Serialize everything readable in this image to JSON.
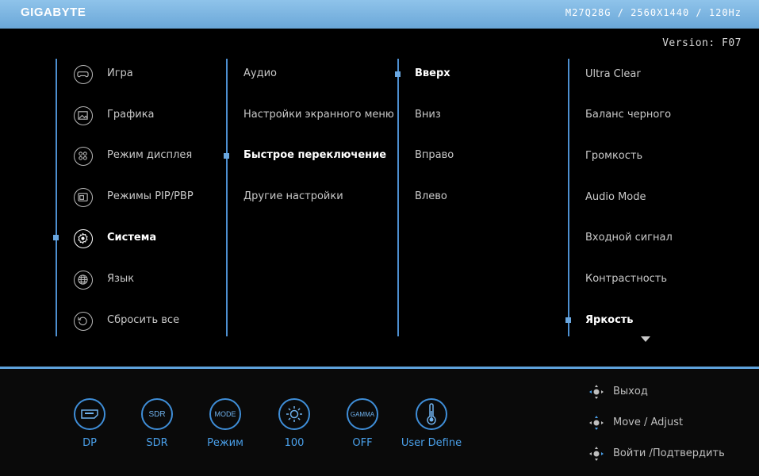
{
  "header": {
    "brand": "GIGABYTE",
    "model_info": "M27Q28G / 2560X1440 / 120Hz",
    "version": "Version: F07"
  },
  "main_menu": {
    "items": [
      {
        "label": "Игра",
        "icon": "gamepad-icon"
      },
      {
        "label": "Графика",
        "icon": "picture-icon"
      },
      {
        "label": "Режим дисплея",
        "icon": "display-mode-icon"
      },
      {
        "label": "Режимы PIP/PBP",
        "icon": "pip-icon"
      },
      {
        "label": "Система",
        "icon": "gear-icon"
      },
      {
        "label": "Язык",
        "icon": "globe-icon"
      },
      {
        "label": "Сбросить все",
        "icon": "reset-icon"
      }
    ],
    "selected_index": 4
  },
  "submenu": {
    "items": [
      "Аудио",
      "Настройки экранного меню",
      "Быстрое переключение",
      "Другие настройки"
    ],
    "selected_index": 2
  },
  "directions": {
    "items": [
      "Вверх",
      "Вниз",
      "Вправо",
      "Влево"
    ],
    "selected_index": 0
  },
  "options": {
    "items": [
      "Ultra Clear",
      "Баланс черного",
      "Громкость",
      "Audio Mode",
      "Входной сигнал",
      "Контрастность",
      "Яркость"
    ],
    "selected_index": 6
  },
  "status_bar": [
    {
      "icon": "input-port-icon",
      "icon_text": "",
      "label": "DP"
    },
    {
      "icon": "sdr-icon",
      "icon_text": "SDR",
      "label": "SDR"
    },
    {
      "icon": "mode-icon",
      "icon_text": "MODE",
      "label": "Режим"
    },
    {
      "icon": "brightness-icon",
      "icon_text": "",
      "label": "100"
    },
    {
      "icon": "gamma-icon",
      "icon_text": "GAMMA",
      "label": "OFF"
    },
    {
      "icon": "thermometer-icon",
      "icon_text": "",
      "label": "User Define"
    }
  ],
  "navigation_hints": [
    {
      "icon": "joystick-left-icon",
      "label": "Выход"
    },
    {
      "icon": "joystick-move-icon",
      "label": "Move / Adjust"
    },
    {
      "icon": "joystick-press-icon",
      "label": "Войти /Подтвердить"
    }
  ],
  "colors": {
    "header": "#6aa7d8",
    "accent": "#4d8fd0",
    "status_text": "#4aa0ea",
    "background": "#000000"
  }
}
